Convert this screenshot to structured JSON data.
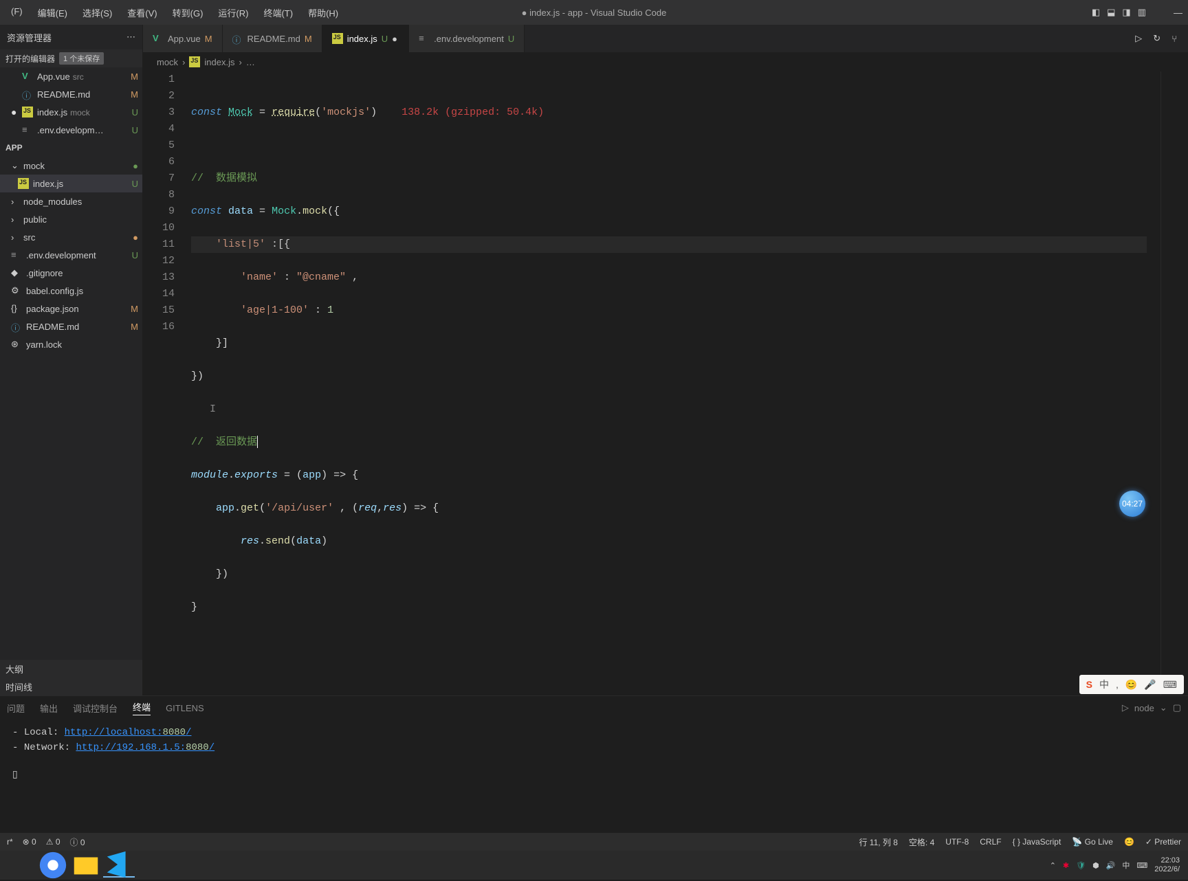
{
  "titlebar": {
    "menus": [
      "(F)",
      "编辑(E)",
      "选择(S)",
      "查看(V)",
      "转到(G)",
      "运行(R)",
      "终端(T)",
      "帮助(H)"
    ],
    "title": "● index.js - app - Visual Studio Code"
  },
  "sidebar": {
    "header": "资源管理器",
    "openEditorsLabel": "打开的编辑器",
    "openEditorsBadge": "1 个未保存",
    "openEditors": [
      {
        "icon": "vue",
        "name": "App.vue",
        "desc": "src",
        "status": "M",
        "statusClass": ""
      },
      {
        "icon": "md",
        "name": "README.md",
        "desc": "",
        "status": "M",
        "statusClass": ""
      },
      {
        "icon": "js",
        "name": "index.js",
        "desc": "mock",
        "status": "U",
        "statusClass": "u",
        "dot": "●"
      },
      {
        "icon": "env",
        "name": ".env.developm…",
        "desc": "",
        "status": "U",
        "statusClass": "u"
      }
    ],
    "appLabel": "APP",
    "tree": [
      {
        "chev": "⌄",
        "name": "mock",
        "status": "●",
        "statusClass": "u",
        "kind": "folder",
        "selected": false
      },
      {
        "icon": "js",
        "name": "index.js",
        "status": "U",
        "statusClass": "u",
        "indent": true,
        "selected": true
      },
      {
        "chev": "›",
        "name": "node_modules",
        "kind": "folder"
      },
      {
        "chev": "›",
        "name": "public",
        "kind": "folder"
      },
      {
        "chev": "›",
        "name": "src",
        "status": "●",
        "statusClass": "",
        "kind": "folder"
      },
      {
        "icon": "env",
        "name": ".env.development",
        "status": "U",
        "statusClass": "u"
      },
      {
        "icon": "git",
        "name": ".gitignore"
      },
      {
        "icon": "babel",
        "name": "babel.config.js"
      },
      {
        "icon": "json",
        "name": "package.json",
        "status": "M"
      },
      {
        "icon": "md",
        "name": "README.md",
        "status": "M"
      },
      {
        "icon": "yarn",
        "name": "yarn.lock"
      }
    ],
    "outline": "大纲",
    "timeline": "时间线"
  },
  "tabs": [
    {
      "icon": "vue",
      "label": "App.vue",
      "mod": "M",
      "modClass": ""
    },
    {
      "icon": "md",
      "label": "README.md",
      "mod": "M",
      "modClass": ""
    },
    {
      "icon": "js",
      "label": "index.js",
      "mod": "U",
      "modClass": "u",
      "active": true,
      "dirty": true
    },
    {
      "icon": "env",
      "label": ".env.development",
      "mod": "U",
      "modClass": "u"
    }
  ],
  "breadcrumb": {
    "root": "mock",
    "file": "index.js",
    "more": "…"
  },
  "code": {
    "lines": 16,
    "sizeHint": "138.2k (gzipped: 50.4k)",
    "l1_kw": "const",
    "l1_v": "Mock",
    "l1_eq": " = ",
    "l1_fn": "require",
    "l1_p1": "(",
    "l1_s": "'mockjs'",
    "l1_p2": ")",
    "l3": "//  数据模拟",
    "l4_kw": "const",
    "l4_v": "data",
    "l4_eq": " = ",
    "l4_t": "Mock",
    "l4_d": ".",
    "l4_fn": "mock",
    "l4_p": "({",
    "l5_s": "'list|5'",
    "l5_p": " :[{",
    "l6_s": "'name'",
    "l6_c": " : ",
    "l6_v": "\"@cname\"",
    "l6_e": " ,",
    "l7_s": "'age|1-100'",
    "l7_c": " : ",
    "l7_n": "1",
    "l8": "}]",
    "l9": "})",
    "l11": "//  返回数据",
    "l12_a": "module",
    "l12_b": ".",
    "l12_c": "exports",
    "l12_d": " = (",
    "l12_e": "app",
    "l12_f": ") => {",
    "l13_a": "app",
    "l13_b": ".",
    "l13_c": "get",
    "l13_d": "(",
    "l13_e": "'/api/user'",
    "l13_f": " , (",
    "l13_g": "req",
    "l13_h": ",",
    "l13_i": "res",
    "l13_j": ") => {",
    "l14_a": "res",
    "l14_b": ".",
    "l14_c": "send",
    "l14_d": "(",
    "l14_e": "data",
    "l14_f": ")",
    "l15": "})",
    "l16": "}"
  },
  "panel": {
    "tabs": [
      "问题",
      "输出",
      "调试控制台",
      "终端",
      "GITLENS"
    ],
    "activeTab": "终端",
    "termKind": "node",
    "localLabel": "Local:",
    "localUrl": "http://localhost:",
    "localPort": "8080",
    "netLabel": "Network:",
    "netUrl": "http://192.168.1.5:",
    "netPort": "8080"
  },
  "statusbar": {
    "left": [
      "r*",
      "⊗ 0",
      "⚠ 0",
      "ⓘ 0"
    ],
    "right": [
      "行 11, 列 8",
      "空格: 4",
      "UTF-8",
      "CRLF",
      "{ } JavaScript",
      "📡 Go Live",
      "😊",
      "✓ Prettier"
    ]
  },
  "taskbar": {
    "timeText": "22:03",
    "dateText": "2022/6/",
    "imeBadge": "中"
  },
  "overlay": {
    "bubble": "04:27",
    "ime": [
      "中",
      ",",
      "😊",
      "🎤"
    ]
  }
}
